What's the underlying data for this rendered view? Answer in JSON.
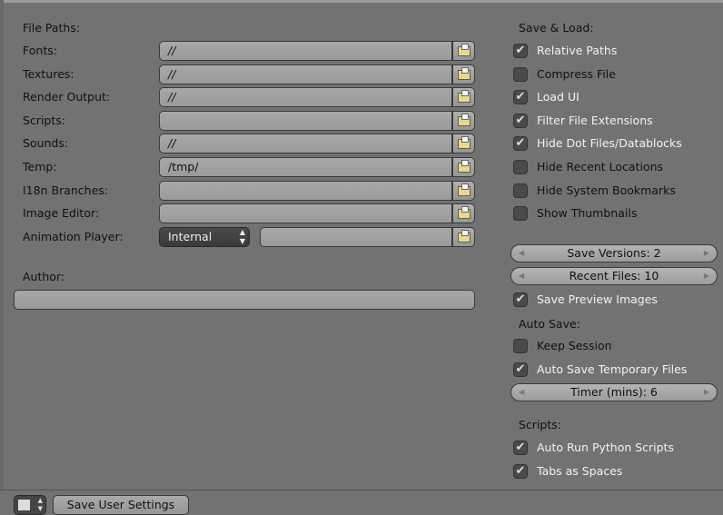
{
  "file_paths": {
    "heading": "File Paths:",
    "rows": [
      {
        "label": "Fonts:",
        "value": "//"
      },
      {
        "label": "Textures:",
        "value": "//"
      },
      {
        "label": "Render Output:",
        "value": "//"
      },
      {
        "label": "Scripts:",
        "value": ""
      },
      {
        "label": "Sounds:",
        "value": "//"
      },
      {
        "label": "Temp:",
        "value": "/tmp/"
      },
      {
        "label": "I18n Branches:",
        "value": ""
      },
      {
        "label": "Image Editor:",
        "value": ""
      }
    ],
    "animation_player": {
      "label": "Animation Player:",
      "select": "Internal",
      "value": ""
    },
    "author": {
      "label": "Author:",
      "value": ""
    }
  },
  "save_load": {
    "heading": "Save & Load:",
    "options": [
      {
        "label": "Relative Paths",
        "checked": true
      },
      {
        "label": "Compress File",
        "checked": false
      },
      {
        "label": "Load UI",
        "checked": true
      },
      {
        "label": "Filter File Extensions",
        "checked": true
      },
      {
        "label": "Hide Dot Files/Datablocks",
        "checked": true
      },
      {
        "label": "Hide Recent Locations",
        "checked": false
      },
      {
        "label": "Hide System Bookmarks",
        "checked": false
      },
      {
        "label": "Show Thumbnails",
        "checked": false
      }
    ],
    "save_versions": "Save Versions: 2",
    "recent_files": "Recent Files: 10",
    "save_preview": {
      "label": "Save Preview Images",
      "checked": true
    }
  },
  "auto_save": {
    "heading": "Auto Save:",
    "keep_session": {
      "label": "Keep Session",
      "checked": false
    },
    "temp_files": {
      "label": "Auto Save Temporary Files",
      "checked": true
    },
    "timer": "Timer (mins): 6"
  },
  "scripts": {
    "heading": "Scripts:",
    "auto_run": {
      "label": "Auto Run Python Scripts",
      "checked": true
    },
    "tabs_spaces": {
      "label": "Tabs as Spaces",
      "checked": true
    }
  },
  "footer": {
    "save_button": "Save User Settings",
    "editor_icon": "preferences-editor-icon"
  }
}
